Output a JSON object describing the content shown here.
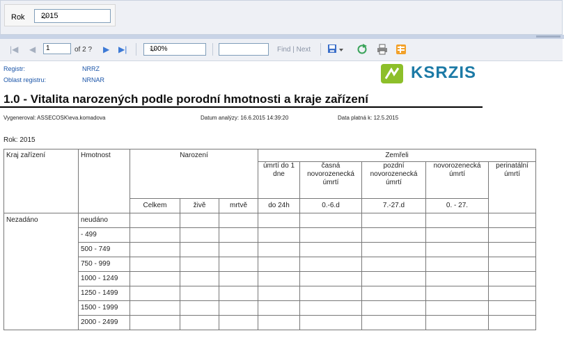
{
  "params": {
    "year_label": "Rok",
    "year_value": "2015"
  },
  "toolbar": {
    "first": "|◀",
    "prev": "◀",
    "page": "1",
    "of": "of 2 ?",
    "next": "▶",
    "last": "▶|",
    "zoom": "100%",
    "find": "Find",
    "sep": "|",
    "find_next": "Next"
  },
  "report": {
    "registr_label": "Registr:",
    "registr_value": "NRRZ",
    "oblast_label": "Oblast registru:",
    "oblast_value": "NRNAR",
    "logo_text": "KSRZIS",
    "title": "1.0 - Vitalita narozených podle porodní hmotnosti a kraje zařízení",
    "generated": "Vygeneroval: ASSECOSK\\eva.komadova",
    "analysis_date": "Datum analýzy: 16.6.2015 14:39:20",
    "valid_date": "Data platná k:  12.5.2015",
    "year": "Rok: 2015"
  },
  "table": {
    "col_kraj": "Kraj zařízení",
    "col_hmotnost": "Hmotnost",
    "col_narozeni": "Narození",
    "col_zemreli": "Zemřeli",
    "sub_umrti24": "úmrtí do 1 dne",
    "sub_casna": "časná novorozenecká úmrtí",
    "sub_pozdni": "pozdní novorozenecká úmrtí",
    "sub_novoroz": "novorozenecká úmrtí",
    "sub_perinat": "perinatální úmrtí",
    "celkem": "Celkem",
    "zive": "živě",
    "mrtve": "mrtvě",
    "do24h": "do 24h",
    "r06": "0.-6.d",
    "r727": "7.-27.d",
    "r027": "0. - 27.",
    "kraj": "Nezadáno",
    "rows": [
      "neudáno",
      "- 499",
      "500 - 749",
      "750 - 999",
      "1000 - 1249",
      "1250 - 1499",
      "1500 - 1999",
      "2000 - 2499"
    ]
  }
}
